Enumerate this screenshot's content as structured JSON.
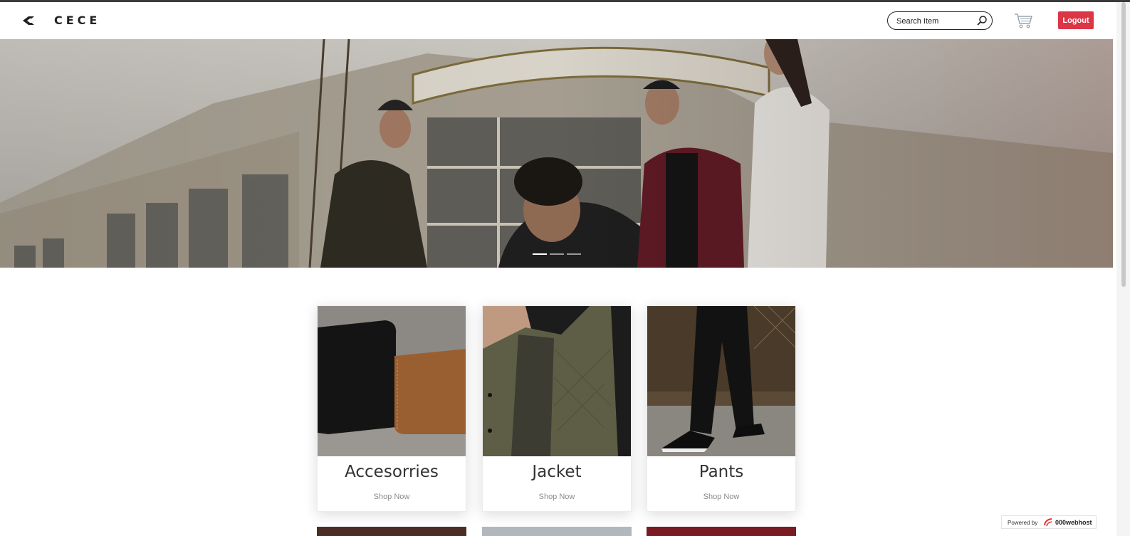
{
  "header": {
    "brand": "CECE",
    "search": {
      "placeholder": "Search Item",
      "value": ""
    },
    "logout_label": "Logout"
  },
  "hero": {
    "slides_count": 3,
    "active_slide": 1
  },
  "categories": [
    {
      "title": "Accesorries",
      "link": "Shop Now"
    },
    {
      "title": "Jacket",
      "link": "Shop Now"
    },
    {
      "title": "Pants",
      "link": "Shop Now"
    }
  ],
  "footer_badge": {
    "powered_by": "Powered by",
    "brand": "000webhost"
  },
  "icons": {
    "brand": "brand-logo-icon",
    "search": "search-icon",
    "cart": "cart-icon"
  },
  "colors": {
    "accent": "#dc3545",
    "text": "#333333"
  }
}
